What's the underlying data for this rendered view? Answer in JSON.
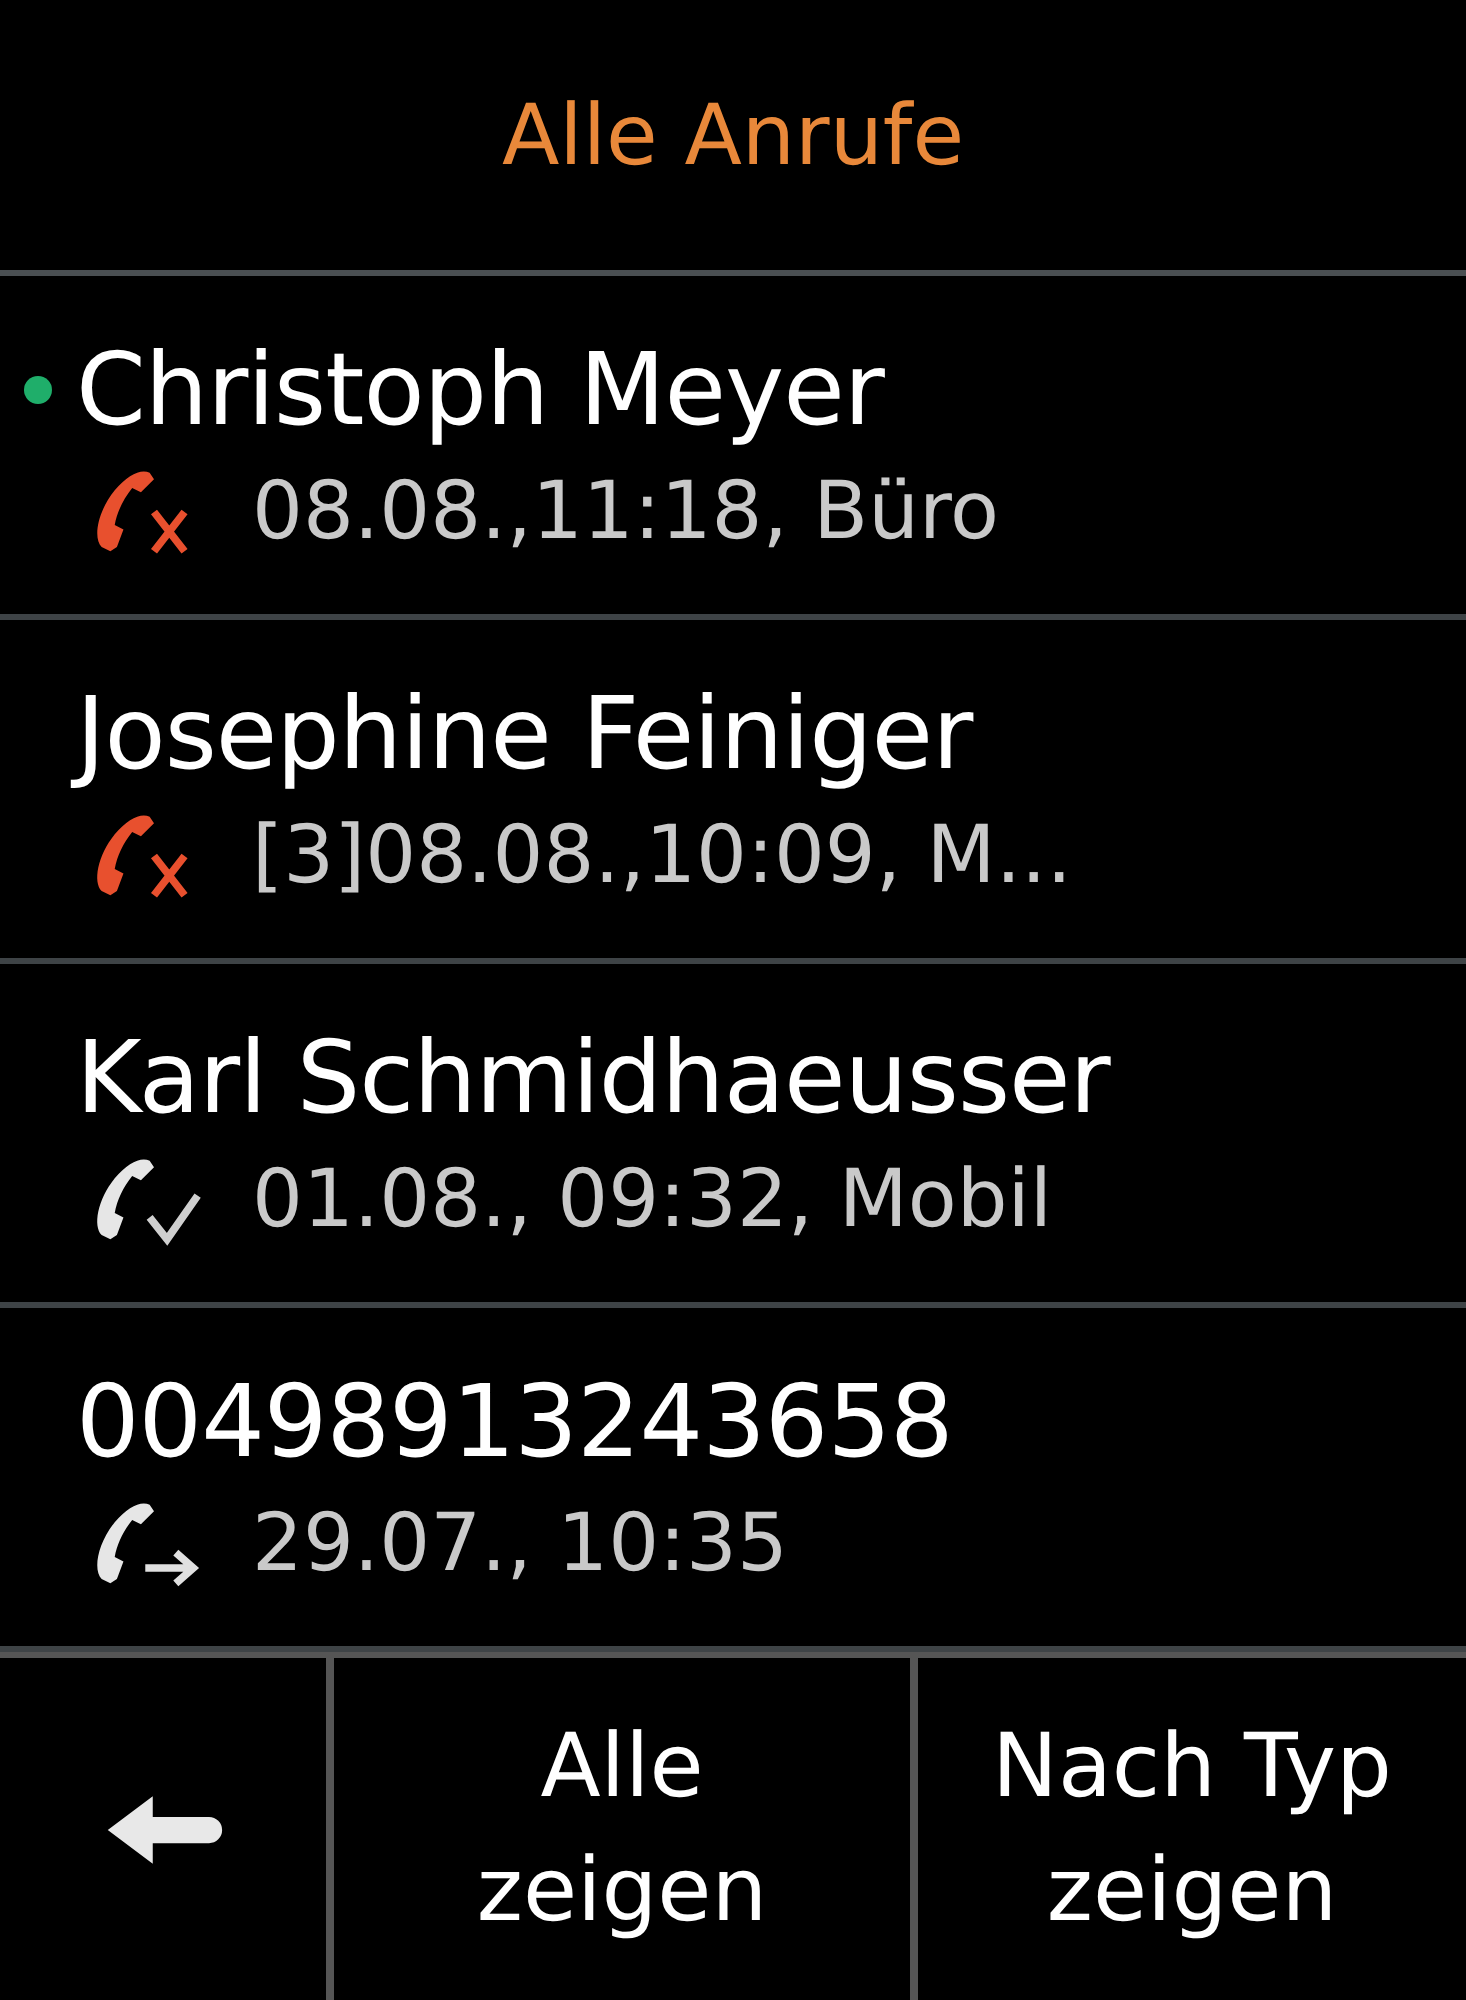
{
  "title": "Alle Anrufe",
  "calls": [
    {
      "name": "Christoph Meyer",
      "detail": "08.08.,11:18, Büro",
      "kind": "missed",
      "unread": true
    },
    {
      "name": "Josephine Feiniger",
      "detail": "[3]08.08.,10:09, M...",
      "kind": "missed",
      "unread": false
    },
    {
      "name": "Karl Schmidhaeusser",
      "detail": "01.08., 09:32, Mobil",
      "kind": "received",
      "unread": false
    },
    {
      "name": "00498913243658",
      "detail": "29.07., 10:35",
      "kind": "outgoing",
      "unread": false
    }
  ],
  "softkeys": [
    "Alle zeigen",
    "Nach Typ zeigen"
  ]
}
